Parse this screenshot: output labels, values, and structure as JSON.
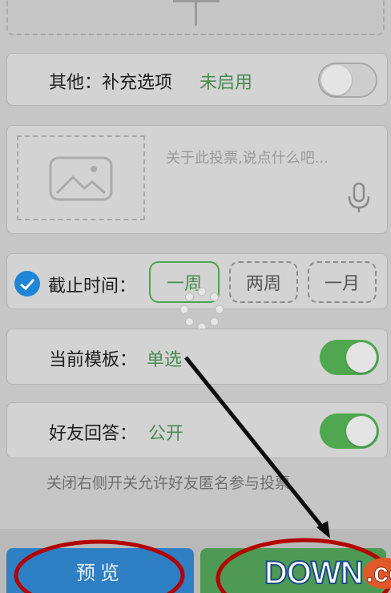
{
  "other_options": {
    "label": "其他：补充选项",
    "status": "未启用",
    "toggle_on": false
  },
  "description": {
    "placeholder": "关于此投票,说点什么吧..."
  },
  "deadline": {
    "label": "截止时间：",
    "options": [
      "一周",
      "两周",
      "一月"
    ],
    "selected": "一周",
    "checked": true
  },
  "template": {
    "label": "当前模板：",
    "value": "单选",
    "toggle_on": true
  },
  "friend_answers": {
    "label": "好友回答：",
    "value": "公开",
    "toggle_on": true
  },
  "hint": "关闭右侧开关允许好友匿名参与投票",
  "buttons": {
    "preview": "预览"
  },
  "watermark": {
    "text": "DOWN",
    "suffix": ".cc"
  },
  "colors": {
    "green": "#4fa84f",
    "blue": "#1f86d6",
    "annotation_red": "#b30000"
  }
}
